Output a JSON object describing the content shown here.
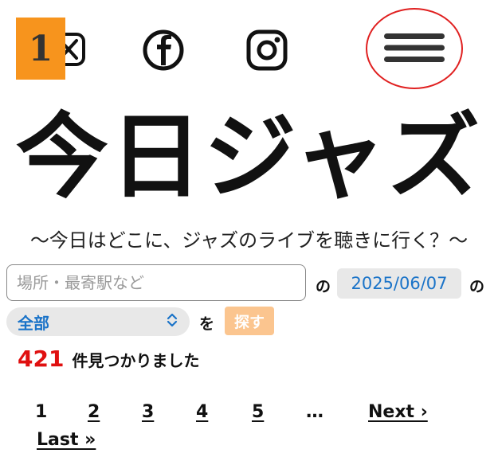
{
  "header": {
    "step_badge": "1",
    "icons": [
      "x-icon",
      "facebook-icon",
      "instagram-icon",
      "hamburger-menu-icon"
    ]
  },
  "brand": {
    "logo_text": "今日ジャズ",
    "tagline": "〜今日はどこに、ジャズのライブを聴きに行く？〜"
  },
  "search": {
    "location_placeholder": "場所・最寄駅など",
    "location_value": "",
    "particle_no_1": "の",
    "date_value": "2025/06/07",
    "particle_no_2": "の",
    "category_selected": "全部",
    "particle_wo": "を",
    "search_button_label": "探す"
  },
  "results": {
    "count": "421",
    "label": "件見つかりました"
  },
  "pagination": {
    "pages": [
      "1",
      "2",
      "3",
      "4",
      "5"
    ],
    "ellipsis": "…",
    "next_label": "Next ›",
    "last_label": "Last »"
  },
  "colors": {
    "accent_blue": "#1a73c8",
    "count_red": "#e01010",
    "badge_orange": "#f7941d",
    "button_peach": "#fbc58f",
    "menu_ring": "#e02020"
  }
}
